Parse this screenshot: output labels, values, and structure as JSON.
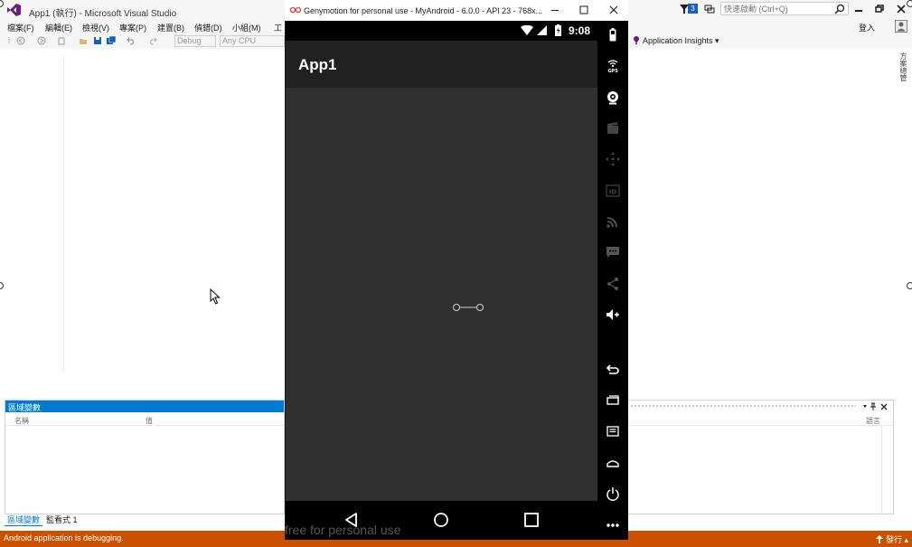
{
  "vs": {
    "title": "App1 (執行) - Microsoft Visual Studio",
    "notification_count": "3",
    "quick_launch_placeholder": "快速啟動 (Ctrl+Q)",
    "menu": [
      "檔案(F)",
      "編輯(E)",
      "檢視(V)",
      "專案(P)",
      "建置(B)",
      "偵錯(D)",
      "小組(M)",
      "工"
    ],
    "login": "登入",
    "toolbar": {
      "config": "Debug",
      "platform": "Any CPU",
      "application_insights": "Application Insights"
    },
    "right_rail": "方案總管",
    "locals": {
      "title": "區域變數",
      "columns": [
        "名稱",
        "值"
      ],
      "lang_col": "語言"
    },
    "bottom_tabs": [
      "區域變數",
      "監看式 1"
    ],
    "status": "Android application is debugging.",
    "publish": "發行"
  },
  "genymotion": {
    "title": "Genymotion for personal use - MyAndroid - 6.0.0 - API 23 - 768x...",
    "watermark": "free for personal use",
    "toolbar_icons": [
      "battery-icon",
      "gps-icon",
      "webcam-icon",
      "camera-icon",
      "dpad-icon",
      "id-icon",
      "rss-icon",
      "sms-icon",
      "share-icon",
      "volume-icon",
      "back-icon",
      "recent-apps-icon",
      "menu-icon",
      "home-icon",
      "power-icon",
      "more-icon"
    ]
  },
  "android": {
    "time": "9:08",
    "app_title": "App1"
  },
  "colors": {
    "vs_accent": "#007acc",
    "status_bar": "#ca5100",
    "android_bg": "#303030",
    "android_appbar": "#212121"
  }
}
